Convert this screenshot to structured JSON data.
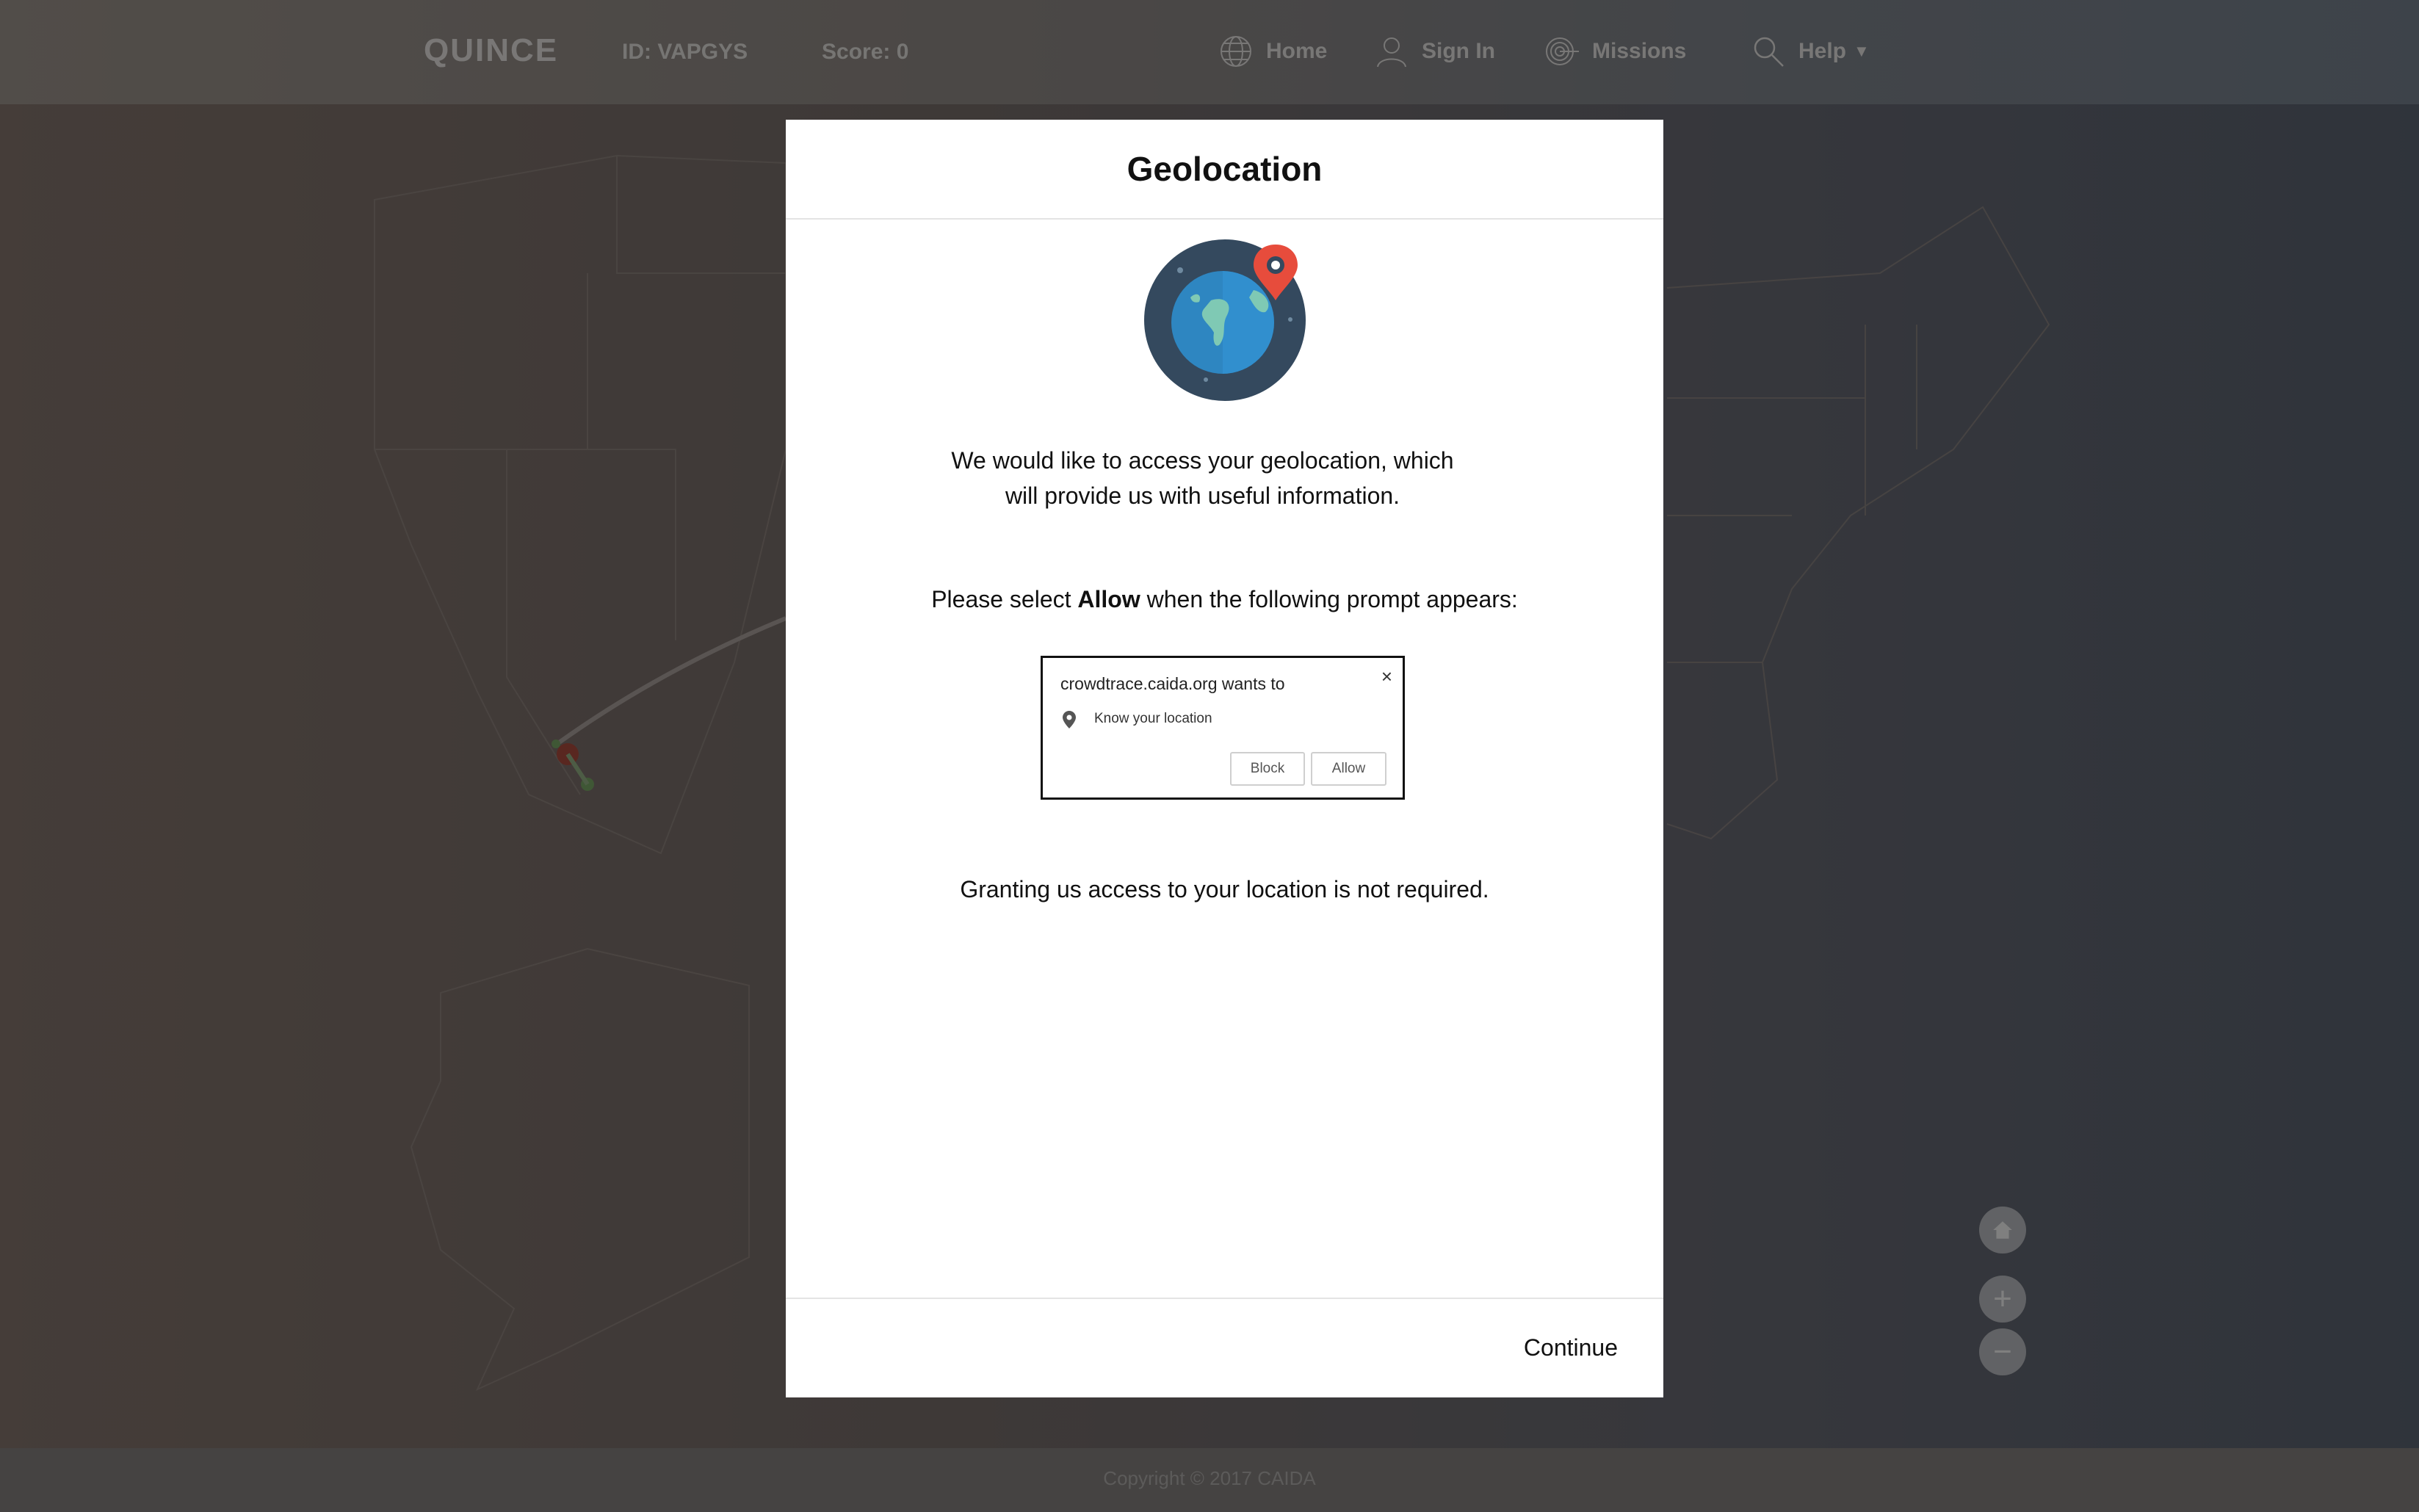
{
  "nav": {
    "brand": "QUINCE",
    "id_label": "ID: VAPGYS",
    "score_label": "Score: 0",
    "items": [
      {
        "label": "Home",
        "icon": "globe-icon"
      },
      {
        "label": "Sign In",
        "icon": "user-icon"
      },
      {
        "label": "Missions",
        "icon": "radar-icon"
      },
      {
        "label": "Help",
        "icon": "search-icon",
        "has_dropdown": true
      }
    ]
  },
  "map_controls": {
    "home_icon": "home-icon",
    "zoom_in_label": "+",
    "zoom_out_label": "−"
  },
  "footer": {
    "copyright": "Copyright © 2017 CAIDA"
  },
  "modal": {
    "title": "Geolocation",
    "illustration_icon": "globe-location-pin-icon",
    "intro_line1": "We would like to access your geolocation, which",
    "intro_line2": "will provide us with useful information.",
    "instruction_prefix": "Please select ",
    "instruction_bold": "Allow",
    "instruction_suffix": " when the following prompt appears:",
    "prompt": {
      "title": "crowdtrace.caida.org wants to",
      "close": "×",
      "permission": "Know your location",
      "block_label": "Block",
      "allow_label": "Allow"
    },
    "note": "Granting us access to your location is not required.",
    "continue_label": "Continue"
  },
  "colors": {
    "overlay": "rgba(0,0,0,0.5)",
    "modal_bg": "#ffffff",
    "pin_red": "#e74c3c",
    "globe_dark": "#34495e",
    "globe_ocean": "#2e86c1",
    "globe_land": "#7fc9b4"
  }
}
